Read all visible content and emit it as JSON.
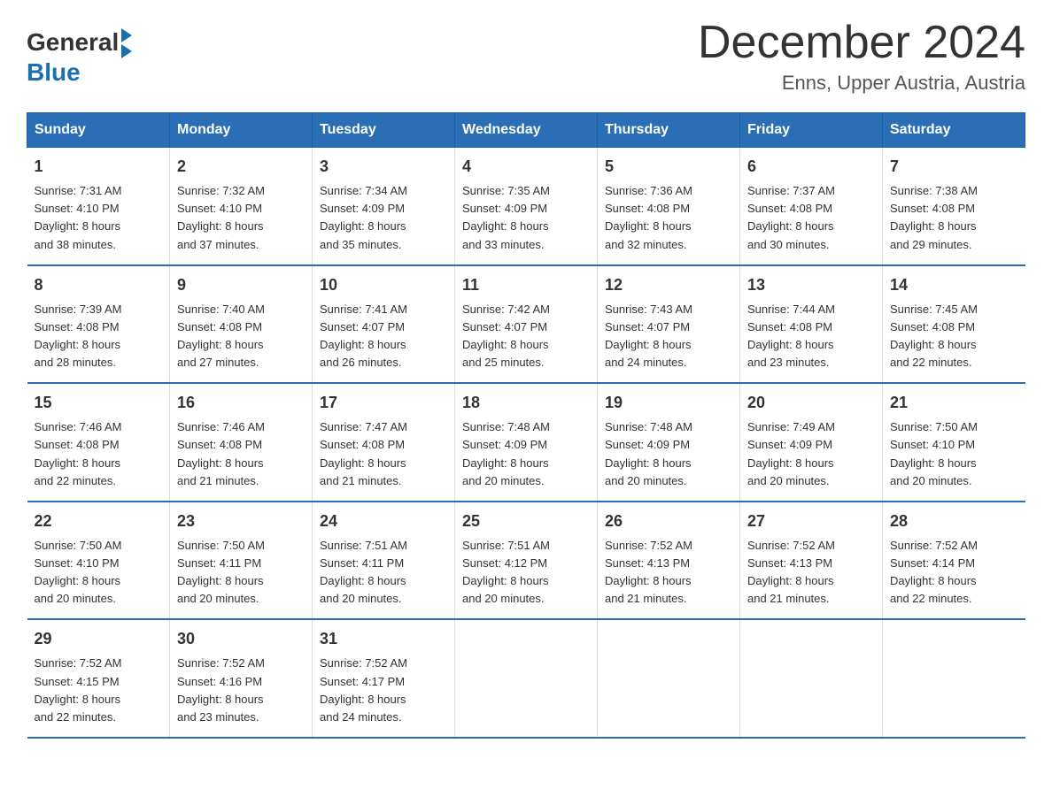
{
  "header": {
    "logo_general": "General",
    "logo_blue": "Blue",
    "month_title": "December 2024",
    "location": "Enns, Upper Austria, Austria"
  },
  "days_of_week": [
    "Sunday",
    "Monday",
    "Tuesday",
    "Wednesday",
    "Thursday",
    "Friday",
    "Saturday"
  ],
  "weeks": [
    [
      {
        "day": "1",
        "sunrise": "7:31 AM",
        "sunset": "4:10 PM",
        "daylight": "8 hours and 38 minutes."
      },
      {
        "day": "2",
        "sunrise": "7:32 AM",
        "sunset": "4:10 PM",
        "daylight": "8 hours and 37 minutes."
      },
      {
        "day": "3",
        "sunrise": "7:34 AM",
        "sunset": "4:09 PM",
        "daylight": "8 hours and 35 minutes."
      },
      {
        "day": "4",
        "sunrise": "7:35 AM",
        "sunset": "4:09 PM",
        "daylight": "8 hours and 33 minutes."
      },
      {
        "day": "5",
        "sunrise": "7:36 AM",
        "sunset": "4:08 PM",
        "daylight": "8 hours and 32 minutes."
      },
      {
        "day": "6",
        "sunrise": "7:37 AM",
        "sunset": "4:08 PM",
        "daylight": "8 hours and 30 minutes."
      },
      {
        "day": "7",
        "sunrise": "7:38 AM",
        "sunset": "4:08 PM",
        "daylight": "8 hours and 29 minutes."
      }
    ],
    [
      {
        "day": "8",
        "sunrise": "7:39 AM",
        "sunset": "4:08 PM",
        "daylight": "8 hours and 28 minutes."
      },
      {
        "day": "9",
        "sunrise": "7:40 AM",
        "sunset": "4:08 PM",
        "daylight": "8 hours and 27 minutes."
      },
      {
        "day": "10",
        "sunrise": "7:41 AM",
        "sunset": "4:07 PM",
        "daylight": "8 hours and 26 minutes."
      },
      {
        "day": "11",
        "sunrise": "7:42 AM",
        "sunset": "4:07 PM",
        "daylight": "8 hours and 25 minutes."
      },
      {
        "day": "12",
        "sunrise": "7:43 AM",
        "sunset": "4:07 PM",
        "daylight": "8 hours and 24 minutes."
      },
      {
        "day": "13",
        "sunrise": "7:44 AM",
        "sunset": "4:08 PM",
        "daylight": "8 hours and 23 minutes."
      },
      {
        "day": "14",
        "sunrise": "7:45 AM",
        "sunset": "4:08 PM",
        "daylight": "8 hours and 22 minutes."
      }
    ],
    [
      {
        "day": "15",
        "sunrise": "7:46 AM",
        "sunset": "4:08 PM",
        "daylight": "8 hours and 22 minutes."
      },
      {
        "day": "16",
        "sunrise": "7:46 AM",
        "sunset": "4:08 PM",
        "daylight": "8 hours and 21 minutes."
      },
      {
        "day": "17",
        "sunrise": "7:47 AM",
        "sunset": "4:08 PM",
        "daylight": "8 hours and 21 minutes."
      },
      {
        "day": "18",
        "sunrise": "7:48 AM",
        "sunset": "4:09 PM",
        "daylight": "8 hours and 20 minutes."
      },
      {
        "day": "19",
        "sunrise": "7:48 AM",
        "sunset": "4:09 PM",
        "daylight": "8 hours and 20 minutes."
      },
      {
        "day": "20",
        "sunrise": "7:49 AM",
        "sunset": "4:09 PM",
        "daylight": "8 hours and 20 minutes."
      },
      {
        "day": "21",
        "sunrise": "7:50 AM",
        "sunset": "4:10 PM",
        "daylight": "8 hours and 20 minutes."
      }
    ],
    [
      {
        "day": "22",
        "sunrise": "7:50 AM",
        "sunset": "4:10 PM",
        "daylight": "8 hours and 20 minutes."
      },
      {
        "day": "23",
        "sunrise": "7:50 AM",
        "sunset": "4:11 PM",
        "daylight": "8 hours and 20 minutes."
      },
      {
        "day": "24",
        "sunrise": "7:51 AM",
        "sunset": "4:11 PM",
        "daylight": "8 hours and 20 minutes."
      },
      {
        "day": "25",
        "sunrise": "7:51 AM",
        "sunset": "4:12 PM",
        "daylight": "8 hours and 20 minutes."
      },
      {
        "day": "26",
        "sunrise": "7:52 AM",
        "sunset": "4:13 PM",
        "daylight": "8 hours and 21 minutes."
      },
      {
        "day": "27",
        "sunrise": "7:52 AM",
        "sunset": "4:13 PM",
        "daylight": "8 hours and 21 minutes."
      },
      {
        "day": "28",
        "sunrise": "7:52 AM",
        "sunset": "4:14 PM",
        "daylight": "8 hours and 22 minutes."
      }
    ],
    [
      {
        "day": "29",
        "sunrise": "7:52 AM",
        "sunset": "4:15 PM",
        "daylight": "8 hours and 22 minutes."
      },
      {
        "day": "30",
        "sunrise": "7:52 AM",
        "sunset": "4:16 PM",
        "daylight": "8 hours and 23 minutes."
      },
      {
        "day": "31",
        "sunrise": "7:52 AM",
        "sunset": "4:17 PM",
        "daylight": "8 hours and 24 minutes."
      },
      null,
      null,
      null,
      null
    ]
  ],
  "labels": {
    "sunrise": "Sunrise: ",
    "sunset": "Sunset: ",
    "daylight": "Daylight: "
  }
}
